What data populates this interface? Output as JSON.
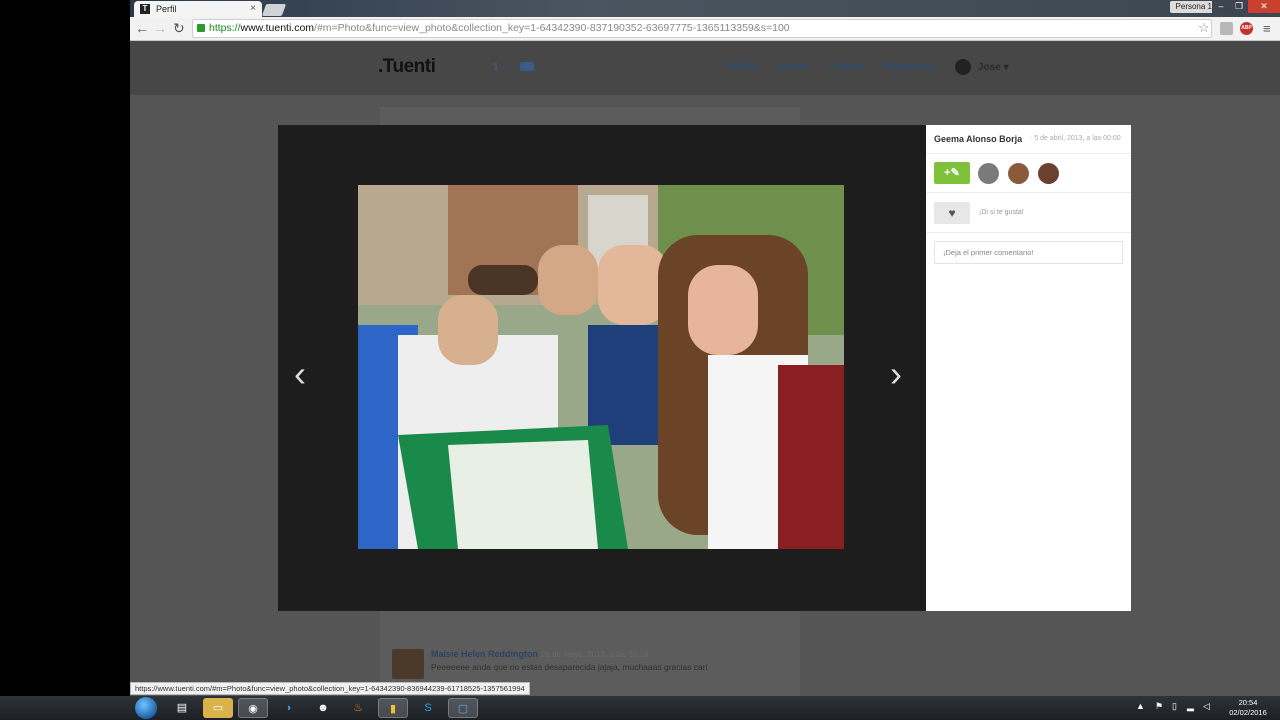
{
  "browser": {
    "tab_title": "Perfil",
    "person_label": "Persona 1",
    "url": {
      "scheme": "https://",
      "host": "www.tuenti.com",
      "path": "/#m=Photo&func=view_photo&collection_key=1-64342390-837190352-63697775-1365113359&s=100"
    },
    "status_url": "https://www.tuenti.com/#m=Photo&func=view_photo&collection_key=1-64342390-836944239-61718525-1357561994"
  },
  "site": {
    "logo": ".Tuenti",
    "notification_count": "1",
    "nav": [
      "Tarifas",
      "Ayuda",
      "Cuenta",
      "Momentos"
    ],
    "user_name": "Jose ▾"
  },
  "viewer": {
    "author": "Geema Alonso Borja",
    "date": "· 5 de abril, 2013, a las 00:00",
    "like_text": "¡Di si te gusta!",
    "comment_placeholder": "¡Deja el primer comentario!",
    "prev_arrow": "‹",
    "next_arrow": "›"
  },
  "background_comment": {
    "author": "Maisie Helen Reddington",
    "date": "26 de mayo, 2013, a las 10:16",
    "text": "Peeeeeee anda que no estas desaparecida jajaja, muchaaas gracias cari"
  },
  "taskbar": {
    "clock_time": "20:54",
    "clock_date": "02/02/2016"
  },
  "icons": [
    "back-icon",
    "forward-icon",
    "reload-icon",
    "lock-icon",
    "star-icon",
    "gear-icon",
    "close-icon",
    "tag-icon",
    "heart-icon",
    "windows-start-icon"
  ],
  "colors": {
    "tuenti_nav": "#2e4d73",
    "tag_green": "#7ec23c",
    "close_red": "#c9402f"
  }
}
